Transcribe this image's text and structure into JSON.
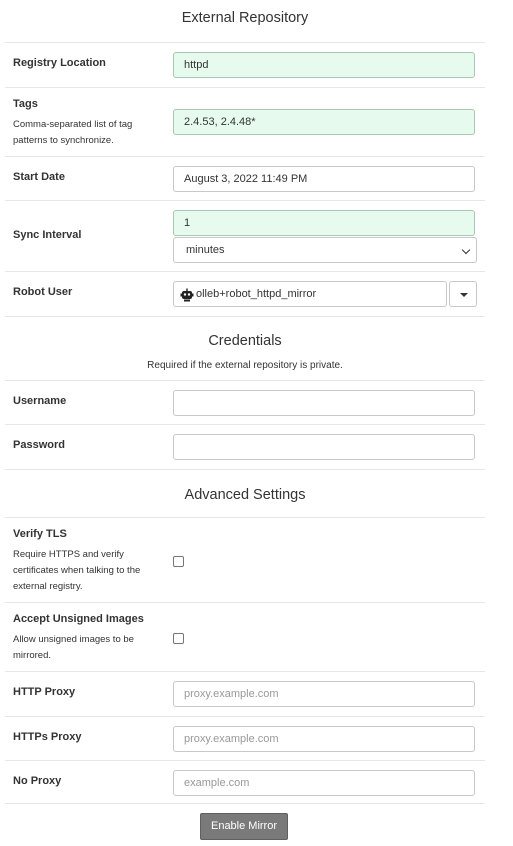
{
  "external_repository": {
    "title": "External Repository",
    "registry_location": {
      "label": "Registry Location",
      "value": "httpd"
    },
    "tags": {
      "label": "Tags",
      "help": "Comma-separated list of tag patterns to synchronize.",
      "value": "2.4.53, 2.4.48*"
    },
    "start_date": {
      "label": "Start Date",
      "value": "August 3, 2022 11:49 PM"
    },
    "sync_interval": {
      "label": "Sync Interval",
      "value": "1",
      "unit": "minutes"
    },
    "robot_user": {
      "label": "Robot User",
      "value": "olleb+robot_httpd_mirror",
      "icon": "robot-icon"
    }
  },
  "credentials": {
    "title": "Credentials",
    "subtitle": "Required if the external repository is private.",
    "username": {
      "label": "Username",
      "value": ""
    },
    "password": {
      "label": "Password",
      "value": ""
    }
  },
  "advanced": {
    "title": "Advanced Settings",
    "verify_tls": {
      "label": "Verify TLS",
      "help": "Require HTTPS and verify certificates when talking to the external registry.",
      "checked": false
    },
    "accept_unsigned": {
      "label": "Accept Unsigned Images",
      "help": "Allow unsigned images to be mirrored.",
      "checked": false
    },
    "http_proxy": {
      "label": "HTTP Proxy",
      "placeholder": "proxy.example.com"
    },
    "https_proxy": {
      "label": "HTTPs Proxy",
      "placeholder": "proxy.example.com"
    },
    "no_proxy": {
      "label": "No Proxy",
      "placeholder": "example.com"
    }
  },
  "actions": {
    "enable_mirror": "Enable Mirror"
  },
  "colors": {
    "valid_field_bg": "#e6fbee",
    "button_bg": "#7a7a7a"
  }
}
